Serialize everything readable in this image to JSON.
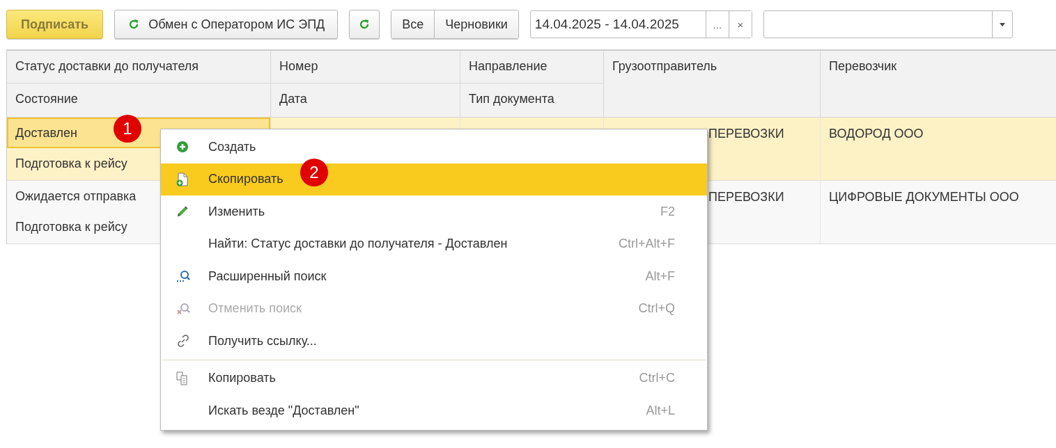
{
  "toolbar": {
    "sign_button": "Подписать",
    "exchange_button": "Обмен с Оператором ИС ЭПД",
    "filter_tabs": [
      {
        "label": "Все",
        "selected": false
      },
      {
        "label": "Черновики",
        "selected": false
      }
    ],
    "period": {
      "value": "14.04.2025 - 14.04.2025",
      "choose": "...",
      "clear": "×"
    }
  },
  "table": {
    "header_rows": [
      [
        "Статус доставки до получателя",
        "Номер",
        "Направление",
        "Грузоотправитель",
        "Перевозчик"
      ],
      [
        "Состояние",
        "Дата",
        "Тип документа"
      ]
    ],
    "rows": [
      {
        "selected": true,
        "status": "Доставлен",
        "state": "Подготовка к рейсу",
        "shipper": "ПЕРЕВОЗКИ",
        "carrier": "ВОДОРОД ООО"
      },
      {
        "selected": false,
        "status": "Ожидается отправка",
        "state": "Подготовка к рейсу",
        "shipper": "ПЕРЕВОЗКИ",
        "carrier": "ЦИФРОВЫЕ ДОКУМЕНТЫ ООО"
      }
    ]
  },
  "context_menu": {
    "items": [
      {
        "label": "Создать",
        "selected": false,
        "disabled": false
      },
      {
        "label": "Скопировать",
        "selected": true,
        "disabled": false
      },
      {
        "label": "Изменить",
        "shortcut": "F2",
        "selected": false,
        "disabled": false
      },
      {
        "label": "Найти: Статус доставки до получателя - Доставлен",
        "shortcut": "Ctrl+Alt+F",
        "selected": false,
        "disabled": false
      },
      {
        "label": "Расширенный поиск",
        "shortcut": "Alt+F",
        "selected": false,
        "disabled": false
      },
      {
        "label": "Отменить поиск",
        "shortcut": "Ctrl+Q",
        "selected": false,
        "disabled": true
      },
      {
        "label": "Получить ссылку...",
        "selected": false,
        "disabled": false,
        "separator_after": true
      },
      {
        "label": "Копировать",
        "shortcut": "Ctrl+C",
        "selected": false,
        "disabled": false
      },
      {
        "label": "Искать везде \"Доставлен\"",
        "shortcut": "Alt+L",
        "selected": false,
        "disabled": false
      }
    ]
  },
  "markers": [
    "1",
    "2"
  ]
}
